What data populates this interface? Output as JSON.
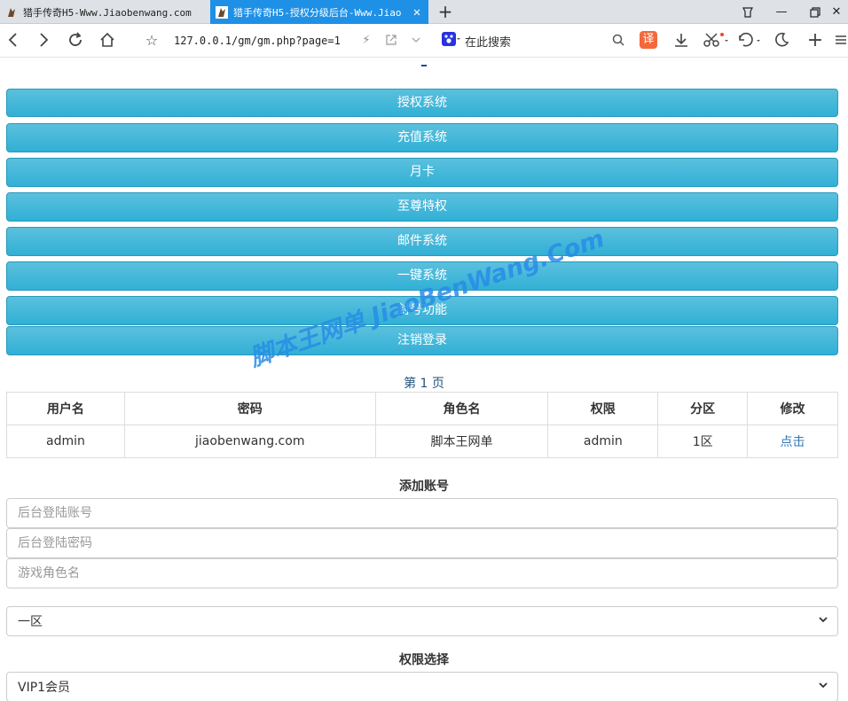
{
  "browser": {
    "tabs": [
      {
        "title": "猎手传奇H5-Www.Jiaobenwang.com",
        "active": false
      },
      {
        "title": "猎手传奇H5-授权分级后台-Www.Jiao",
        "active": true
      }
    ],
    "address": "127.0.0.1/gm/gm.php?page=1",
    "search_placeholder": "在此搜索",
    "translate_label": "译",
    "active_tab_color": "#1e90e6"
  },
  "page": {
    "menu": [
      "授权系统",
      "充值系统",
      "月卡",
      "至尊特权",
      "邮件系统",
      "一键系统",
      "封号功能",
      "注销登录"
    ],
    "pager": "第 1 页",
    "table": {
      "headers": [
        "用户名",
        "密码",
        "角色名",
        "权限",
        "分区",
        "修改"
      ],
      "rows": [
        [
          "admin",
          "jiaobenwang.com",
          "脚本王网单",
          "admin",
          "1区",
          "点击"
        ]
      ]
    },
    "add_account": {
      "title": "添加账号",
      "account_placeholder": "后台登陆账号",
      "password_placeholder": "后台登陆密码",
      "role_placeholder": "游戏角色名",
      "zone_selected": "一区"
    },
    "permission": {
      "title": "权限选择",
      "selected": "VIP1会员"
    },
    "watermark": "脚本王网单 JiaoBenWang.Com",
    "button_color": "#31b0d5"
  }
}
